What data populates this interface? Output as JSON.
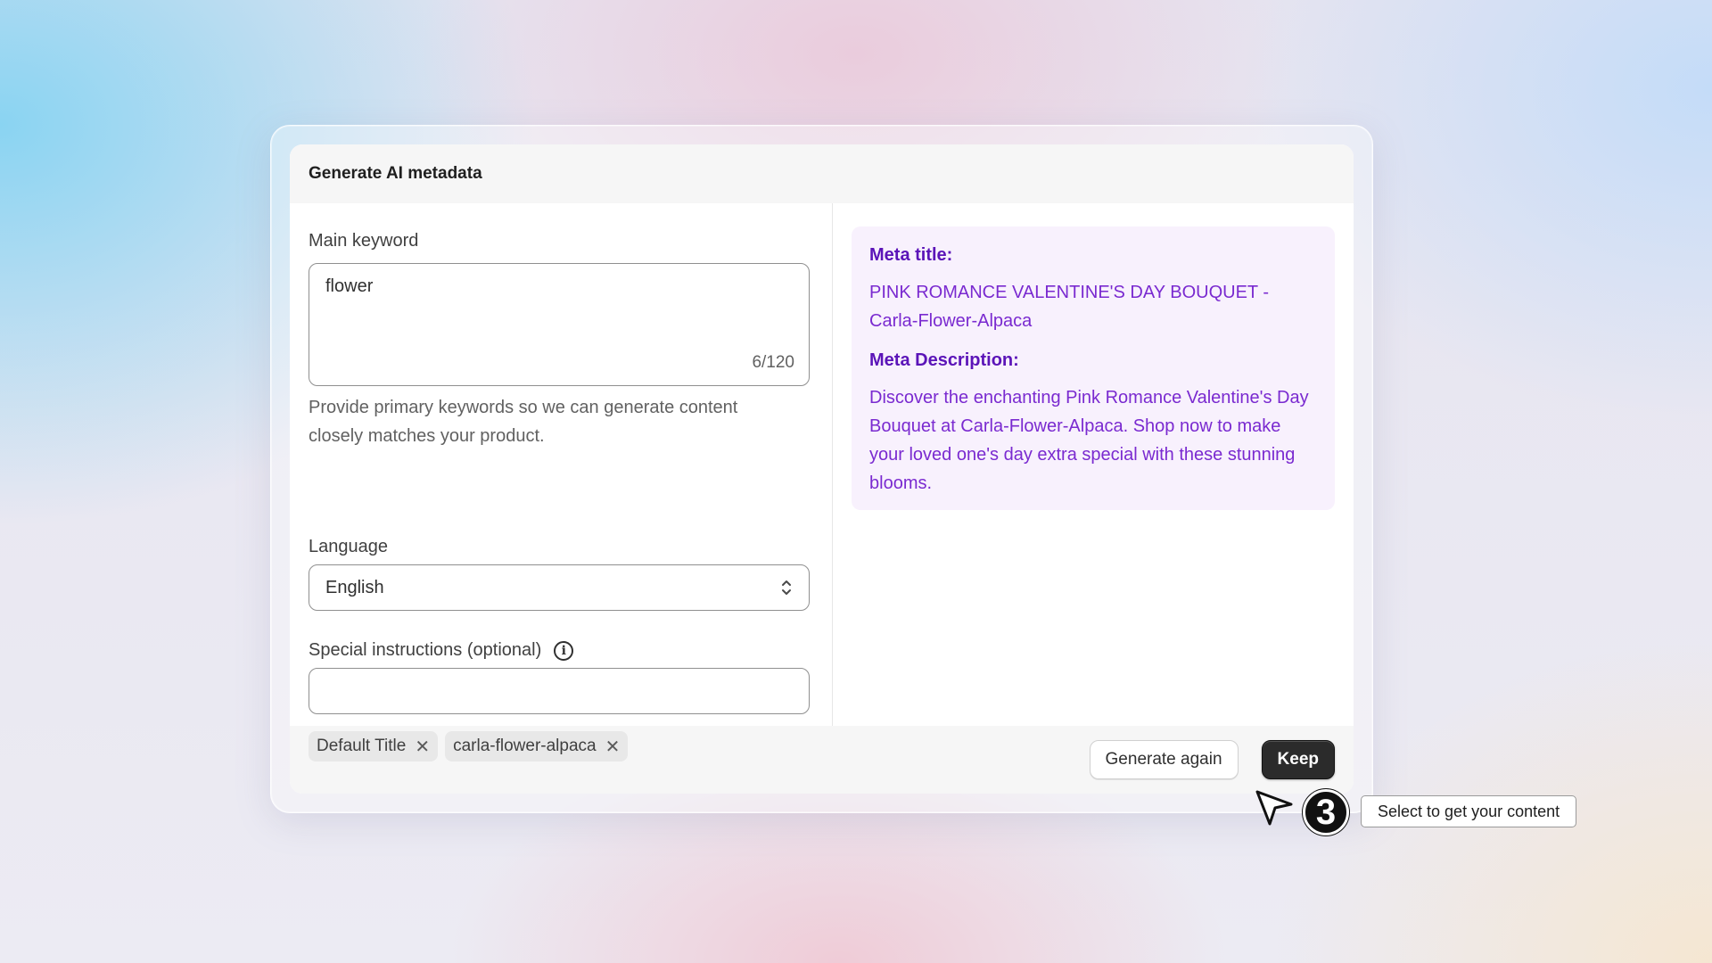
{
  "modal": {
    "title": "Generate AI metadata"
  },
  "form": {
    "main_keyword_label": "Main keyword",
    "main_keyword_value": "flower",
    "main_keyword_count": "6/120",
    "main_keyword_help": "Provide primary keywords so we can generate content closely matches your product.",
    "language_label": "Language",
    "language_value": "English",
    "special_instructions_label": "Special instructions (optional)",
    "special_instructions_value": "",
    "tags": [
      {
        "label": "Default Title"
      },
      {
        "label": "carla-flower-alpaca"
      }
    ]
  },
  "result": {
    "meta_title_label": "Meta title:",
    "meta_title_value": "PINK ROMANCE VALENTINE'S DAY BOUQUET - Carla-Flower-Alpaca",
    "meta_description_label": "Meta Description:",
    "meta_description_value": "Discover the enchanting Pink Romance Valentine's Day Bouquet at Carla-Flower-Alpaca. Shop now to make your loved one's day extra special with these stunning blooms."
  },
  "footer": {
    "generate_again_label": "Generate again",
    "keep_label": "Keep"
  },
  "overlay": {
    "step_number": "3",
    "tooltip_text": "Select to get your content"
  },
  "icons": {
    "info": "info-icon",
    "remove_tag": "close-icon",
    "select_chevron": "chevron-up-down-icon",
    "cursor": "cursor-arrow-icon"
  },
  "colors": {
    "accent_purple": "#6b1fc4",
    "result_bg": "#f8f1fd",
    "primary_button": "#2b2b2b"
  }
}
